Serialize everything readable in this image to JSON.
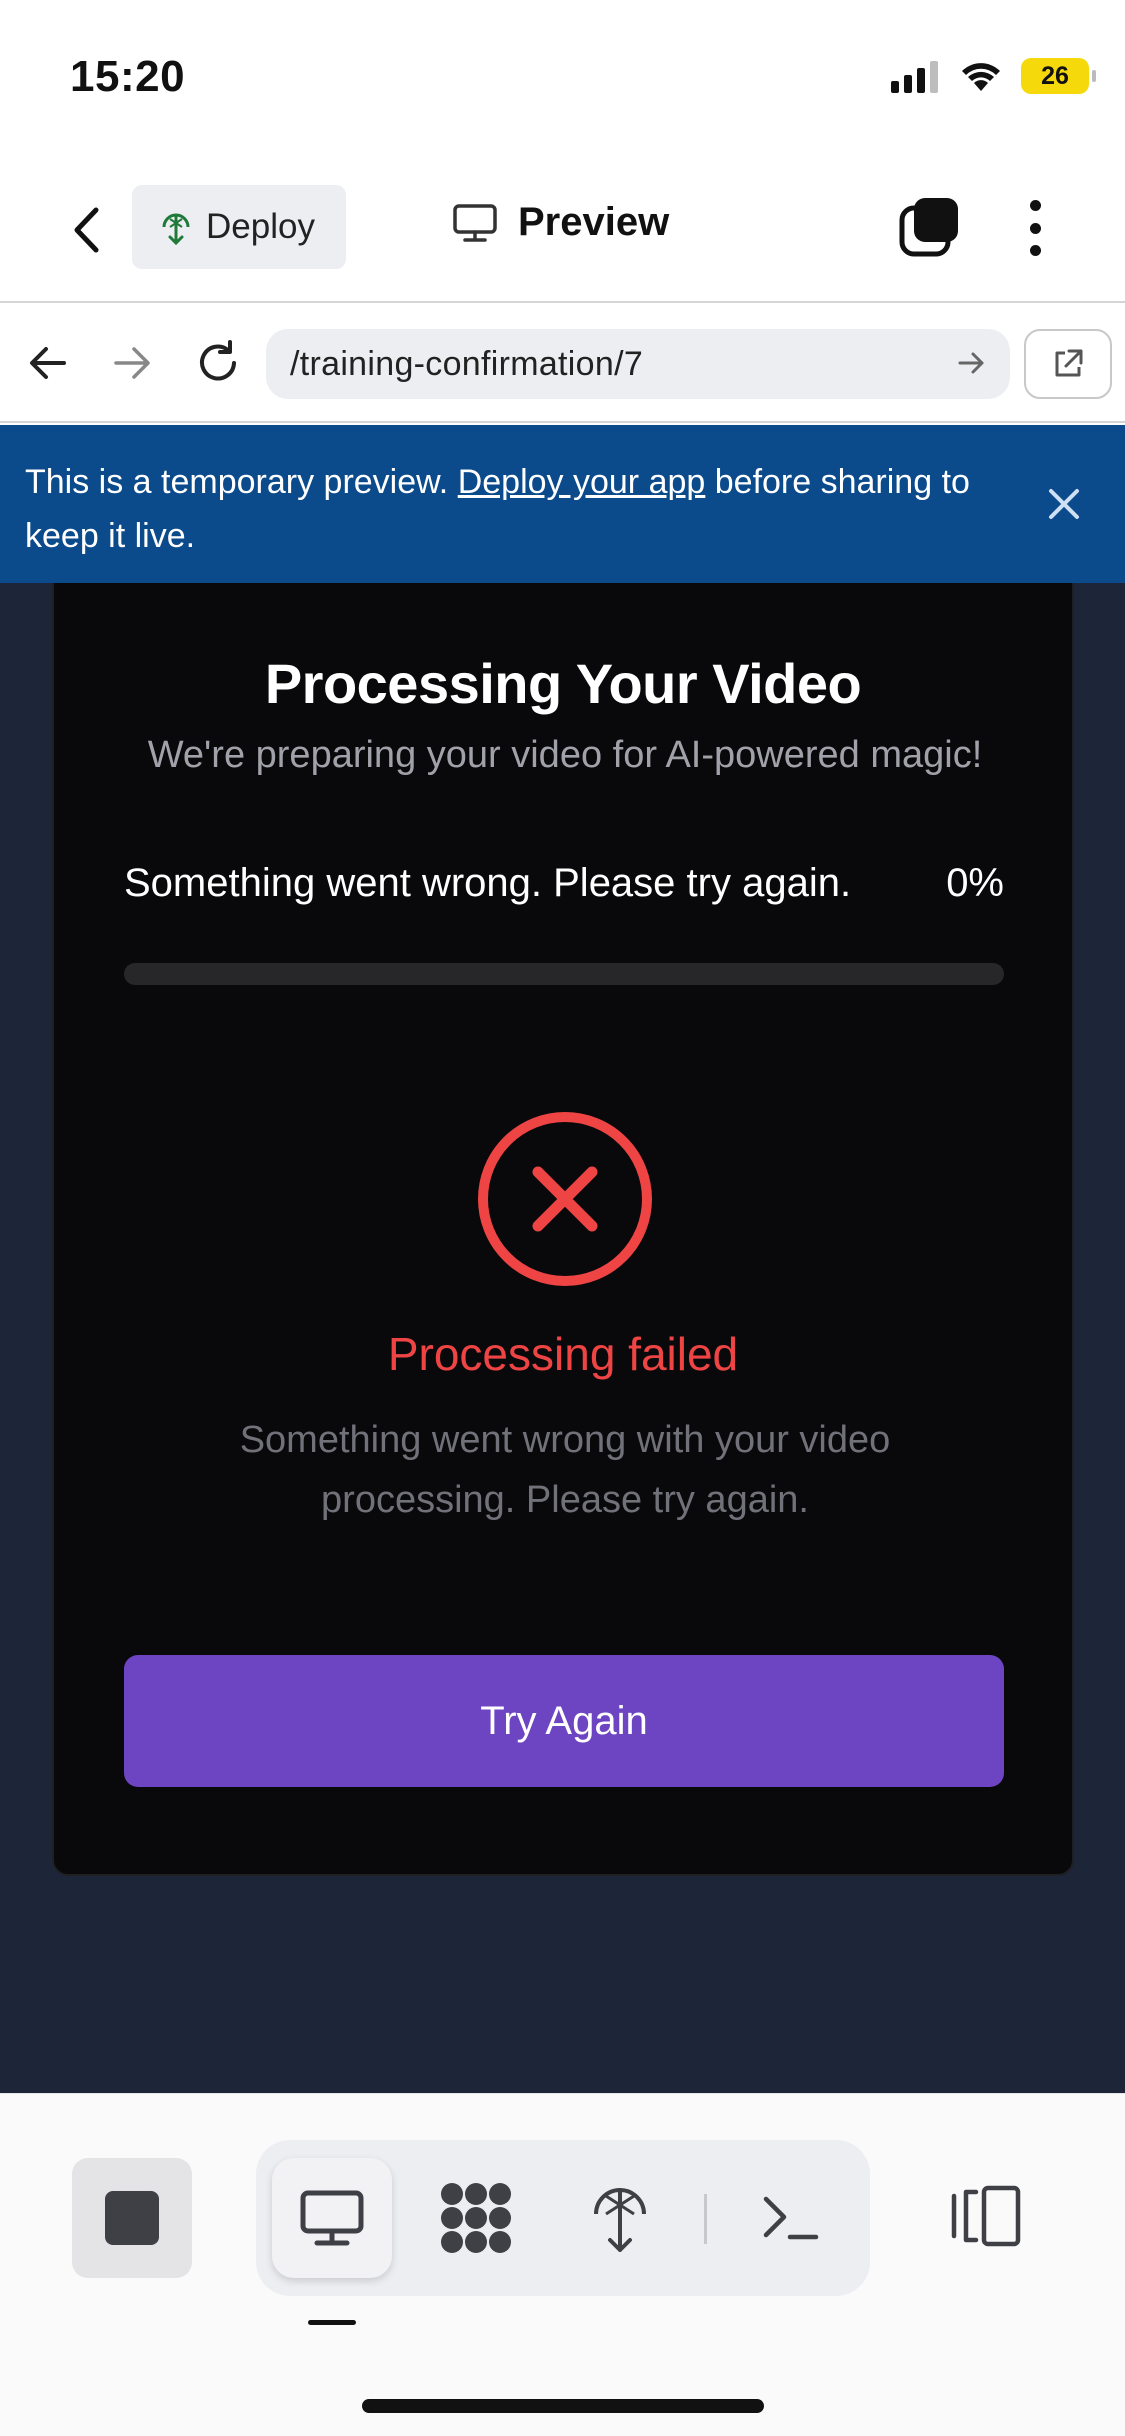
{
  "status_bar": {
    "time": "15:20",
    "battery": "26"
  },
  "header": {
    "deploy_label": "Deploy",
    "preview_label": "Preview"
  },
  "url_bar": {
    "url": "/training-confirmation/7"
  },
  "banner": {
    "text_before": "This is a temporary preview. ",
    "link": "Deploy your app",
    "text_after": " before sharing to keep it live."
  },
  "card": {
    "title": "Processing Your Video",
    "subtitle": "We're preparing your video for AI-powered magic!",
    "status_message": "Something went wrong. Please try again.",
    "progress_text": "0%",
    "progress_fraction": 0,
    "fail_title": "Processing failed",
    "fail_description": "Something went wrong with your video processing. Please try again.",
    "button_label": "Try Again"
  },
  "colors": {
    "banner_bg": "#0b4a8b",
    "error_red": "#ef4444",
    "button_purple": "#6d44c2",
    "page_bg": "#1d2639",
    "card_bg": "#09090b"
  },
  "icons": {
    "status": [
      "signal-icon",
      "wifi-icon",
      "battery-icon"
    ],
    "header": [
      "back-icon",
      "deploy-icon",
      "monitor-icon",
      "tabs-icon",
      "more-icon"
    ],
    "url": [
      "nav-back-icon",
      "nav-forward-icon",
      "reload-icon",
      "go-arrow-icon",
      "external-link-icon"
    ],
    "toolbar": [
      "stop-icon",
      "preview-monitor-icon",
      "integrations-icon",
      "deploy-icon",
      "terminal-icon",
      "split-view-icon"
    ]
  }
}
